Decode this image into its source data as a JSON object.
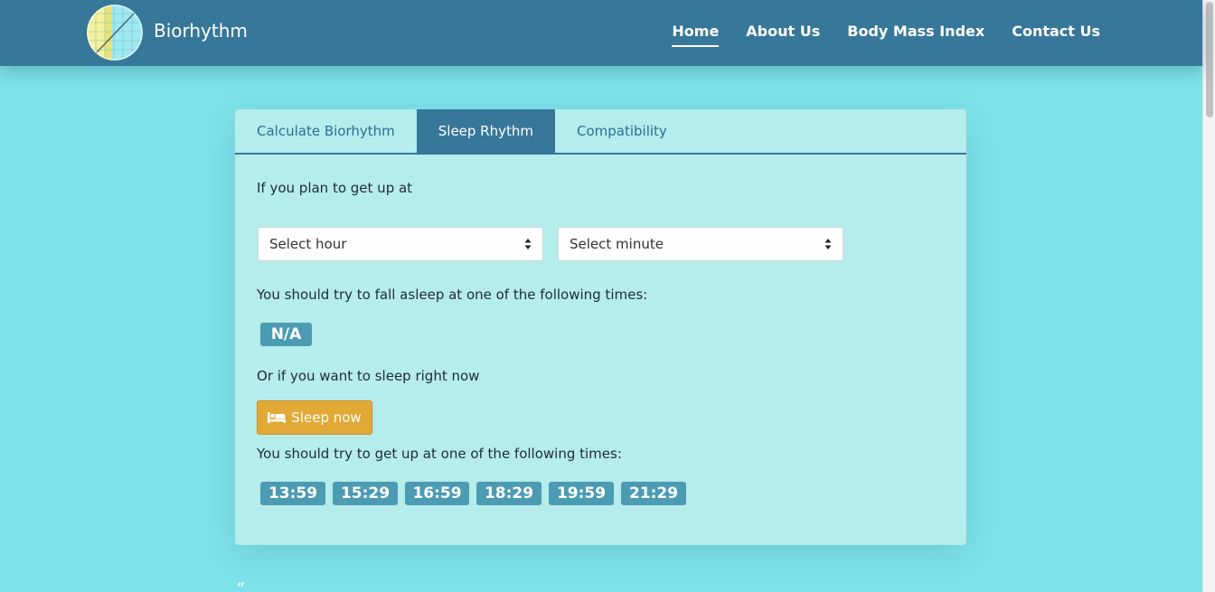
{
  "header": {
    "brand": "Biorhythm",
    "nav": [
      "Home",
      "About Us",
      "Body Mass Index",
      "Contact Us"
    ],
    "active_nav": "Home"
  },
  "tabs": [
    "Calculate Biorhythm",
    "Sleep Rhythm",
    "Compatibility"
  ],
  "active_tab": "Sleep Rhythm",
  "sleep": {
    "plan_label": "If you plan to get up at",
    "hour_select": "Select hour",
    "minute_select": "Select minute",
    "fall_asleep_label": "You should try to fall asleep at one of the following times:",
    "fall_asleep_value": "N/A",
    "sleep_now_label": "Or if you want to sleep right now",
    "sleep_now_button": "Sleep now",
    "wake_label": "You should try to get up at one of the following times:",
    "wake_times": [
      "13:59",
      "15:29",
      "16:59",
      "18:29",
      "19:59",
      "21:29"
    ]
  },
  "footer": {
    "quote_mark": "“"
  },
  "colors": {
    "background": "#7ee3ea",
    "navbar": "#37779a",
    "card": "#b5ecec",
    "badge": "#4b9bb3",
    "sleep_button": "#e2a937"
  },
  "icons": {
    "bed": "bed-icon",
    "select_arrow": "sort-arrows-icon"
  }
}
